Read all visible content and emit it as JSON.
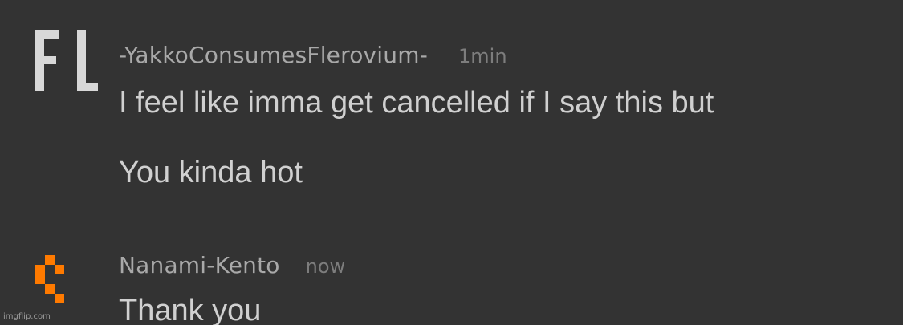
{
  "comments": [
    {
      "avatar_icon": "fl-letters-avatar-icon",
      "username": "-YakkoConsumesFlerovium-",
      "time": "1min",
      "lines": [
        "I feel like imma get cancelled if I say this but",
        "You kinda hot"
      ]
    },
    {
      "avatar_icon": "orange-pixel-avatar-icon",
      "avatar_color": "#ff7a00",
      "username": "Nanami-Kento",
      "time": "now",
      "lines": [
        "Thank you"
      ]
    }
  ],
  "watermark": "imgflip.com",
  "colors": {
    "background": "#333333",
    "username": "#a9a9a9",
    "timestamp": "#7d7d7d",
    "text": "#d0d0d0",
    "accent": "#ff7a00"
  }
}
